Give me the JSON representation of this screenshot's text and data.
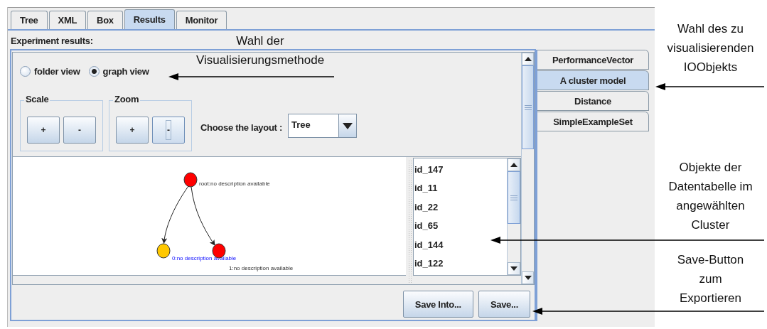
{
  "tabs": [
    {
      "label": "Tree",
      "selected": false
    },
    {
      "label": "XML",
      "selected": false
    },
    {
      "label": "Box",
      "selected": false
    },
    {
      "label": "Results",
      "selected": true
    },
    {
      "label": "Monitor",
      "selected": false
    }
  ],
  "heading": "Experiment results:",
  "view_options": [
    {
      "label": "folder view",
      "selected": false
    },
    {
      "label": "graph view",
      "selected": true
    }
  ],
  "groups": [
    {
      "title": "Scale",
      "buttons": [
        {
          "label": "+",
          "focused": false
        },
        {
          "label": "-",
          "focused": false
        }
      ]
    },
    {
      "title": "Zoom",
      "buttons": [
        {
          "label": "+",
          "focused": false
        },
        {
          "label": "-",
          "focused": true
        }
      ]
    }
  ],
  "layout_label": "Choose the layout :",
  "layout_value": "Tree",
  "graph": {
    "nodes": [
      {
        "label": "root:no description available",
        "color": "#ff0000",
        "selected": false
      },
      {
        "label": "0:no description available",
        "color": "#ffc800",
        "selected": true
      },
      {
        "label": "1:no description available",
        "color": "#ff0000",
        "selected": false
      }
    ]
  },
  "objects": [
    "id_147",
    "id_11",
    "id_22",
    "id_65",
    "id_144",
    "id_122"
  ],
  "buttons": [
    "Save Into...",
    "Save..."
  ],
  "object_tabs": [
    {
      "label": "PerformanceVector",
      "selected": false
    },
    {
      "label": "A cluster model",
      "selected": true
    },
    {
      "label": "Distance",
      "selected": false
    },
    {
      "label": "SimpleExampleSet",
      "selected": false
    }
  ],
  "annotations": [
    {
      "text": "Wahl der\nVisualisierungsmethode"
    },
    {
      "text": "Wahl des zu\nvisualisierenden\nIOObjekts"
    },
    {
      "text": "Objekte der\nDatentabelle im\nangewählten\nCluster"
    },
    {
      "text": "Save-Button\nzum\nExportieren"
    }
  ]
}
